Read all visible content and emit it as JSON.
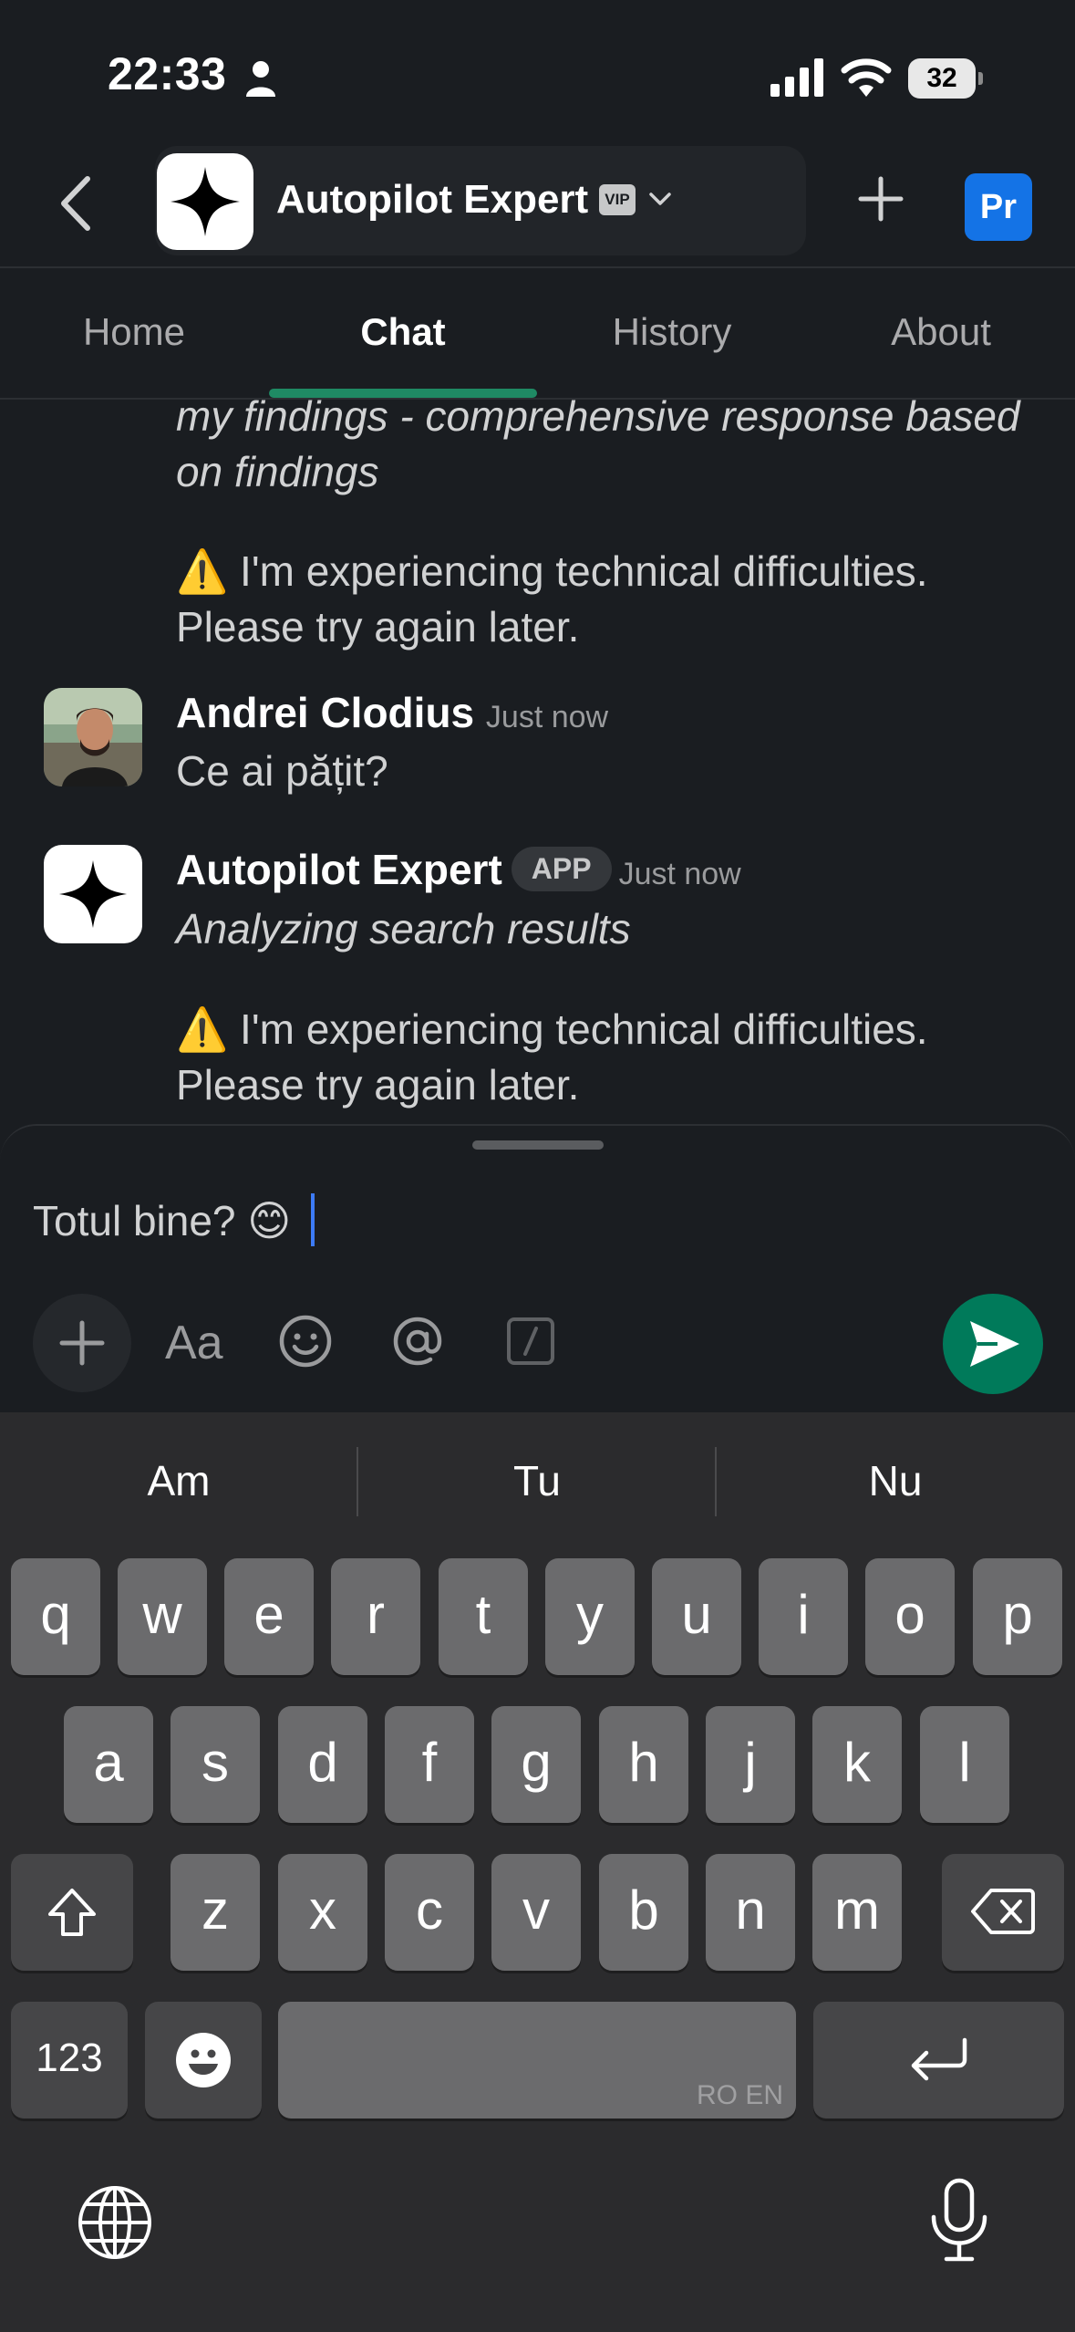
{
  "status_bar": {
    "time": "22:33",
    "battery": "32"
  },
  "header": {
    "channel_name": "Autopilot Expert",
    "vip_label": "VIP",
    "profile_initials": "Pr"
  },
  "tabs": [
    {
      "label": "Home"
    },
    {
      "label": "Chat",
      "active": true
    },
    {
      "label": "History"
    },
    {
      "label": "About"
    }
  ],
  "messages": {
    "partial_line_1": "my findings - comprehensive response based",
    "partial_line_2": "on findings",
    "error_1_line_1": "⚠️ I'm experiencing technical difficulties.",
    "error_1_line_2": "Please try again later.",
    "user_sender": "Andrei Clodius",
    "user_time": "Just now",
    "user_text": "Ce ai pățit?",
    "bot_sender": "Autopilot Expert",
    "bot_badge": "APP",
    "bot_time": "Just now",
    "bot_status": "Analyzing search results",
    "error_2_line_1": "⚠️ I'm experiencing technical difficulties.",
    "error_2_line_2": "Please try again later."
  },
  "composer": {
    "input_value": "Totul bine? 😊",
    "format_label": "Aa"
  },
  "keyboard": {
    "suggestions": [
      "Am",
      "Tu",
      "Nu"
    ],
    "row1": [
      "q",
      "w",
      "e",
      "r",
      "t",
      "y",
      "u",
      "i",
      "o",
      "p"
    ],
    "row2": [
      "a",
      "s",
      "d",
      "f",
      "g",
      "h",
      "j",
      "k",
      "l"
    ],
    "row3": [
      "z",
      "x",
      "c",
      "v",
      "b",
      "n",
      "m"
    ],
    "numbers_label": "123",
    "space_languages": "RO EN"
  },
  "colors": {
    "background": "#1a1d21",
    "accent_green": "#007a5a",
    "tab_underline": "#1f8a64",
    "profile_blue": "#1473e6"
  }
}
